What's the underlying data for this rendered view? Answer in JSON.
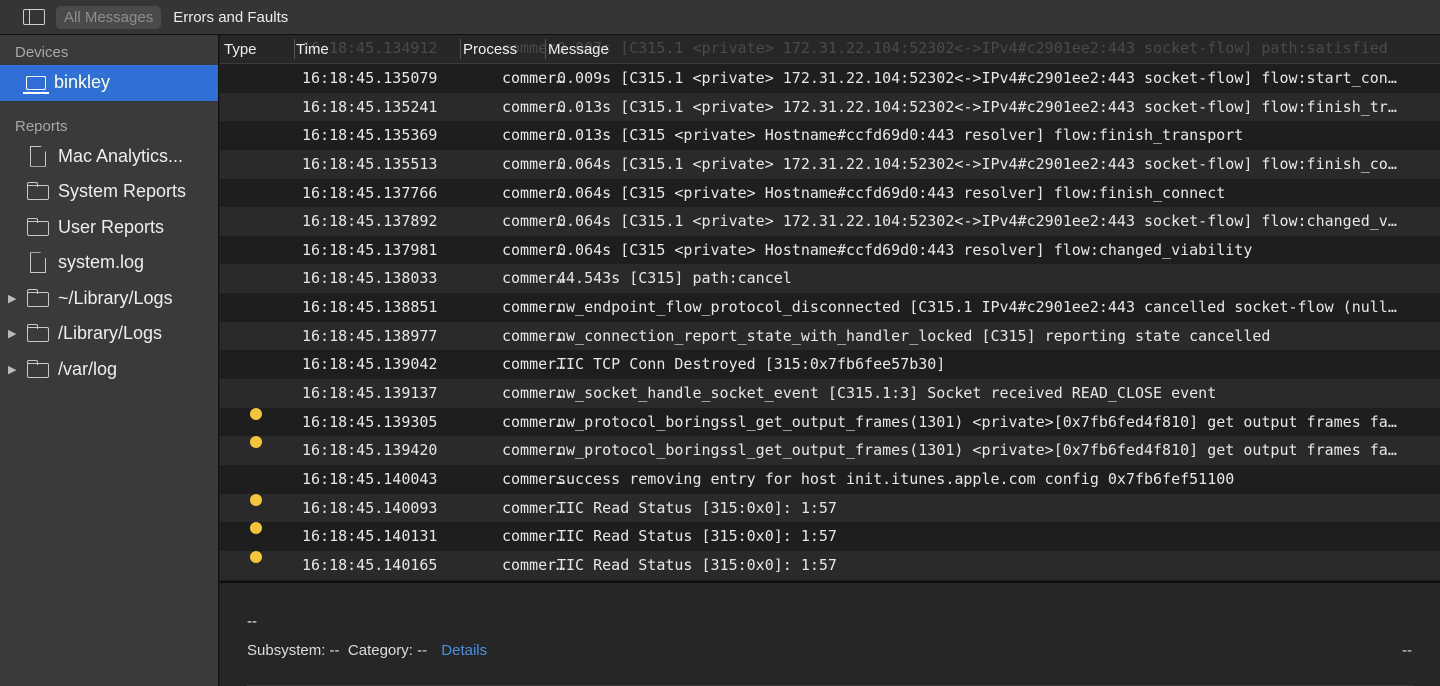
{
  "toolbar": {
    "tabs": [
      "All Messages",
      "Errors and Faults"
    ],
    "active_tab": "All Messages"
  },
  "sidebar": {
    "devices_label": "Devices",
    "device": "binkley",
    "reports_label": "Reports",
    "items": [
      {
        "label": "Mac Analytics...",
        "icon": "document-icon",
        "expandable": false
      },
      {
        "label": "System Reports",
        "icon": "folder-icon",
        "expandable": false
      },
      {
        "label": "User Reports",
        "icon": "folder-icon",
        "expandable": false
      },
      {
        "label": "system.log",
        "icon": "document-icon",
        "expandable": false
      },
      {
        "label": "~/Library/Logs",
        "icon": "folder-icon",
        "expandable": true
      },
      {
        "label": "/Library/Logs",
        "icon": "folder-icon",
        "expandable": true
      },
      {
        "label": "/var/log",
        "icon": "folder-icon",
        "expandable": true
      }
    ]
  },
  "table": {
    "columns": [
      "Type",
      "Time",
      "Process",
      "Message"
    ],
    "partial_row": {
      "time": "16:18:45.134912",
      "process": "commer…",
      "message": "0.007s [C315.1 <private> 172.31.22.104:52302<->IPv4#c2901ee2:443 socket-flow] path:satisfied"
    },
    "rows": [
      {
        "type": "",
        "time": "16:18:45.135079",
        "process": "commer…",
        "message": "0.009s [C315.1 <private> 172.31.22.104:52302<->IPv4#c2901ee2:443 socket-flow] flow:start_con…"
      },
      {
        "type": "",
        "time": "16:18:45.135241",
        "process": "commer…",
        "message": "0.013s [C315.1 <private> 172.31.22.104:52302<->IPv4#c2901ee2:443 socket-flow] flow:finish_tr…"
      },
      {
        "type": "",
        "time": "16:18:45.135369",
        "process": "commer…",
        "message": "0.013s [C315 <private> Hostname#ccfd69d0:443 resolver] flow:finish_transport"
      },
      {
        "type": "",
        "time": "16:18:45.135513",
        "process": "commer…",
        "message": "0.064s [C315.1 <private> 172.31.22.104:52302<->IPv4#c2901ee2:443 socket-flow] flow:finish_co…"
      },
      {
        "type": "",
        "time": "16:18:45.137766",
        "process": "commer…",
        "message": "0.064s [C315 <private> Hostname#ccfd69d0:443 resolver] flow:finish_connect"
      },
      {
        "type": "",
        "time": "16:18:45.137892",
        "process": "commer…",
        "message": "0.064s [C315.1 <private> 172.31.22.104:52302<->IPv4#c2901ee2:443 socket-flow] flow:changed_v…"
      },
      {
        "type": "",
        "time": "16:18:45.137981",
        "process": "commer…",
        "message": "0.064s [C315 <private> Hostname#ccfd69d0:443 resolver] flow:changed_viability"
      },
      {
        "type": "",
        "time": "16:18:45.138033",
        "process": "commer…",
        "message": "44.543s [C315] path:cancel"
      },
      {
        "type": "",
        "time": "16:18:45.138851",
        "process": "commer…",
        "message": "nw_endpoint_flow_protocol_disconnected [C315.1 IPv4#c2901ee2:443 cancelled socket-flow (null…"
      },
      {
        "type": "",
        "time": "16:18:45.138977",
        "process": "commer…",
        "message": "nw_connection_report_state_with_handler_locked [C315] reporting state cancelled"
      },
      {
        "type": "",
        "time": "16:18:45.139042",
        "process": "commer…",
        "message": "TIC TCP Conn Destroyed [315:0x7fb6fee57b30]"
      },
      {
        "type": "",
        "time": "16:18:45.139137",
        "process": "commer…",
        "message": "nw_socket_handle_socket_event [C315.1:3] Socket received READ_CLOSE event"
      },
      {
        "type": "error",
        "time": "16:18:45.139305",
        "process": "commer…",
        "message": "nw_protocol_boringssl_get_output_frames(1301) <private>[0x7fb6fed4f810] get output frames fa…"
      },
      {
        "type": "error",
        "time": "16:18:45.139420",
        "process": "commer…",
        "message": "nw_protocol_boringssl_get_output_frames(1301) <private>[0x7fb6fed4f810] get output frames fa…"
      },
      {
        "type": "",
        "time": "16:18:45.140043",
        "process": "commer…",
        "message": "success removing entry for host init.itunes.apple.com config 0x7fb6fef51100"
      },
      {
        "type": "error",
        "time": "16:18:45.140093",
        "process": "commer…",
        "message": "TIC Read Status [315:0x0]: 1:57"
      },
      {
        "type": "error",
        "time": "16:18:45.140131",
        "process": "commer…",
        "message": "TIC Read Status [315:0x0]: 1:57"
      },
      {
        "type": "error",
        "time": "16:18:45.140165",
        "process": "commer…",
        "message": "TIC Read Status [315:0x0]: 1:57"
      }
    ]
  },
  "detail": {
    "title": "--",
    "subsystem_label": "Subsystem:",
    "subsystem": "--",
    "category_label": "Category:",
    "category": "--",
    "details_link": "Details",
    "right_value": "--"
  },
  "colors": {
    "selection": "#2f6fd6",
    "error_dot": "#f4c53c",
    "link": "#4a90e2"
  }
}
